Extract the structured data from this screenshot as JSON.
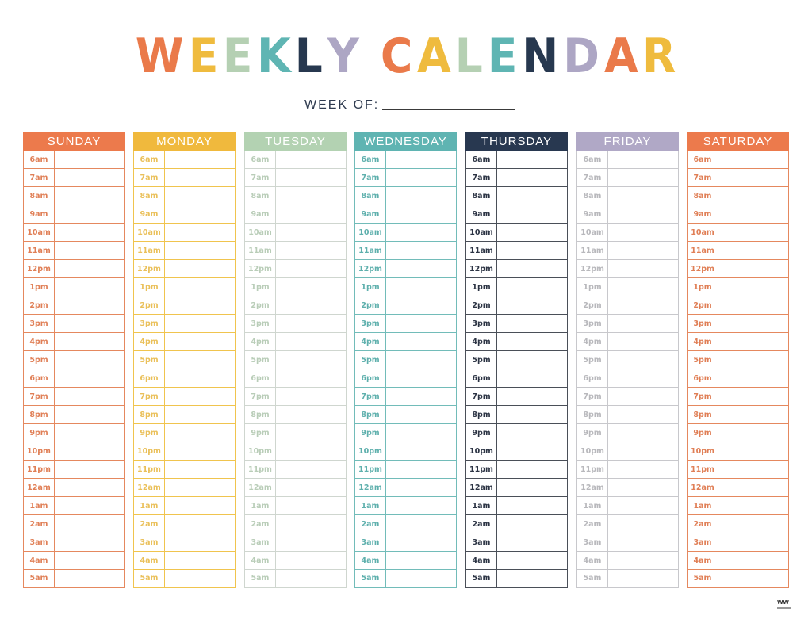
{
  "title": {
    "text": "WEEKLY CALENDAR",
    "letters": [
      {
        "ch": "W",
        "color": "#ea7a4a"
      },
      {
        "ch": "E",
        "color": "#efbb3e"
      },
      {
        "ch": "E",
        "color": "#b5d0b3"
      },
      {
        "ch": "K",
        "color": "#5fb5b3"
      },
      {
        "ch": "L",
        "color": "#27384f"
      },
      {
        "ch": "Y",
        "color": "#ada6c4"
      },
      {
        "ch": " ",
        "color": "#ffffff"
      },
      {
        "ch": "C",
        "color": "#ea7a4a"
      },
      {
        "ch": "A",
        "color": "#efbb3e"
      },
      {
        "ch": "L",
        "color": "#b5d0b3"
      },
      {
        "ch": "E",
        "color": "#5fb5b3"
      },
      {
        "ch": "N",
        "color": "#27384f"
      },
      {
        "ch": "D",
        "color": "#ada6c4"
      },
      {
        "ch": "A",
        "color": "#ea7a4a"
      },
      {
        "ch": "R",
        "color": "#efbb3e"
      }
    ]
  },
  "week_of": {
    "label": "WEEK OF:",
    "value": ""
  },
  "times": [
    "6am",
    "7am",
    "8am",
    "9am",
    "10am",
    "11am",
    "12pm",
    "1pm",
    "2pm",
    "3pm",
    "4pm",
    "5pm",
    "6pm",
    "7pm",
    "8pm",
    "9pm",
    "10pm",
    "11pm",
    "12am",
    "1am",
    "2am",
    "3am",
    "4am",
    "5am"
  ],
  "days": [
    {
      "name": "SUNDAY",
      "header_color": "#ec7a4c",
      "border_color": "#e5885e",
      "text_color": "#e07f56"
    },
    {
      "name": "MONDAY",
      "header_color": "#f0b93d",
      "border_color": "#f0c44e",
      "text_color": "#eac05a"
    },
    {
      "name": "TUESDAY",
      "header_color": "#b3d2b2",
      "border_color": "#cfd6cf",
      "text_color": "#b9cdb8"
    },
    {
      "name": "WEDNESDAY",
      "header_color": "#5fb4b2",
      "border_color": "#72bcb9",
      "text_color": "#5fb0ad"
    },
    {
      "name": "THURSDAY",
      "header_color": "#283850",
      "border_color": "#4a4f58",
      "text_color": "#2c3444"
    },
    {
      "name": "FRIDAY",
      "header_color": "#b0a8c6",
      "border_color": "#c8c8cc",
      "text_color": "#b8b8bc"
    },
    {
      "name": "SATURDAY",
      "header_color": "#ec7a4c",
      "border_color": "#e5885e",
      "text_color": "#e07f56"
    }
  ],
  "logo": {
    "text": "WW"
  }
}
